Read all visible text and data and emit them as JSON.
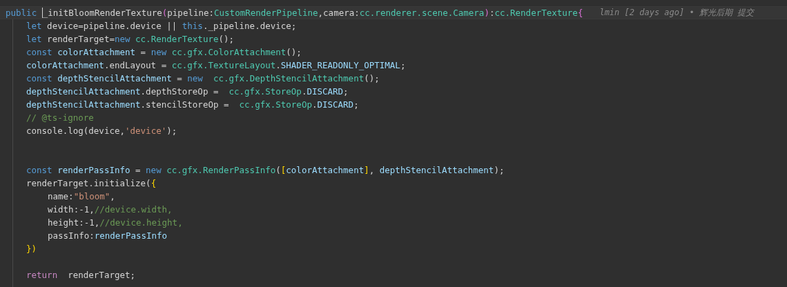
{
  "code": {
    "blame": "lmin [2 days ago] • 辉光后期 提交",
    "lines": [
      {
        "current": true,
        "kind": "top",
        "tokens": [
          {
            "t": "public ",
            "kind": "kw"
          },
          {
            "t": "_initBloomRenderTexture",
            "kind": "plain",
            "cursor": true
          },
          {
            "t": "(",
            "kind": "paren"
          },
          {
            "t": "pipeline:",
            "kind": "plain"
          },
          {
            "t": "CustomRenderPipeline",
            "kind": "type"
          },
          {
            "t": ",camera:",
            "kind": "plain"
          },
          {
            "t": "cc.renderer.scene.Camera",
            "kind": "type"
          },
          {
            "t": ")",
            "kind": "paren"
          },
          {
            "t": ":",
            "kind": "plain"
          },
          {
            "t": "cc.RenderTexture",
            "kind": "type"
          },
          {
            "t": "{",
            "kind": "paren"
          }
        ]
      },
      {
        "current": false,
        "kind": "body",
        "tokens": [
          {
            "t": "let ",
            "kind": "kw"
          },
          {
            "t": "device=pipeline.device || ",
            "kind": "plain"
          },
          {
            "t": "this",
            "kind": "kw"
          },
          {
            "t": "._pipeline.device;",
            "kind": "plain"
          }
        ]
      },
      {
        "current": false,
        "kind": "body",
        "tokens": [
          {
            "t": "let ",
            "kind": "kw"
          },
          {
            "t": "renderTarget=",
            "kind": "plain"
          },
          {
            "t": "new ",
            "kind": "kw"
          },
          {
            "t": "cc.RenderTexture",
            "kind": "type"
          },
          {
            "t": "();",
            "kind": "plain"
          }
        ]
      },
      {
        "current": false,
        "kind": "body",
        "tokens": [
          {
            "t": "const ",
            "kind": "kw"
          },
          {
            "t": "colorAttachment",
            "kind": "var"
          },
          {
            "t": " = ",
            "kind": "plain"
          },
          {
            "t": "new ",
            "kind": "kw"
          },
          {
            "t": "cc.gfx.ColorAttachment",
            "kind": "type"
          },
          {
            "t": "();",
            "kind": "plain"
          }
        ]
      },
      {
        "current": false,
        "kind": "body",
        "tokens": [
          {
            "t": "colorAttachment",
            "kind": "var"
          },
          {
            "t": ".endLayout = ",
            "kind": "plain"
          },
          {
            "t": "cc.gfx.TextureLayout",
            "kind": "type"
          },
          {
            "t": ".",
            "kind": "plain"
          },
          {
            "t": "SHADER_READONLY_OPTIMAL",
            "kind": "var"
          },
          {
            "t": ";",
            "kind": "plain"
          }
        ]
      },
      {
        "current": false,
        "kind": "body",
        "tokens": [
          {
            "t": "const ",
            "kind": "kw"
          },
          {
            "t": "depthStencilAttachment",
            "kind": "var"
          },
          {
            "t": " = ",
            "kind": "plain"
          },
          {
            "t": "new  ",
            "kind": "kw"
          },
          {
            "t": "cc.gfx.DepthStencilAttachment",
            "kind": "type"
          },
          {
            "t": "();",
            "kind": "plain"
          }
        ]
      },
      {
        "current": false,
        "kind": "body",
        "tokens": [
          {
            "t": "depthStencilAttachment",
            "kind": "var"
          },
          {
            "t": ".depthStoreOp =  ",
            "kind": "plain"
          },
          {
            "t": "cc.gfx.StoreOp",
            "kind": "type"
          },
          {
            "t": ".",
            "kind": "plain"
          },
          {
            "t": "DISCARD",
            "kind": "var"
          },
          {
            "t": ";",
            "kind": "plain"
          }
        ]
      },
      {
        "current": false,
        "kind": "body",
        "tokens": [
          {
            "t": "depthStencilAttachment",
            "kind": "var"
          },
          {
            "t": ".stencilStoreOp =  ",
            "kind": "plain"
          },
          {
            "t": "cc.gfx.StoreOp",
            "kind": "type"
          },
          {
            "t": ".",
            "kind": "plain"
          },
          {
            "t": "DISCARD",
            "kind": "var"
          },
          {
            "t": ";",
            "kind": "plain"
          }
        ]
      },
      {
        "current": false,
        "kind": "body",
        "tokens": [
          {
            "t": "// @ts-ignore",
            "kind": "com"
          }
        ]
      },
      {
        "current": false,
        "kind": "body",
        "tokens": [
          {
            "t": "console.log(device,",
            "kind": "plain"
          },
          {
            "t": "'device'",
            "kind": "str"
          },
          {
            "t": ");",
            "kind": "plain"
          }
        ]
      },
      {
        "current": false,
        "kind": "blank"
      },
      {
        "current": false,
        "kind": "blank"
      },
      {
        "current": false,
        "kind": "body",
        "tokens": [
          {
            "t": "const ",
            "kind": "kw"
          },
          {
            "t": "renderPassInfo",
            "kind": "var"
          },
          {
            "t": " = ",
            "kind": "plain"
          },
          {
            "t": "new ",
            "kind": "kw"
          },
          {
            "t": "cc.gfx.RenderPassInfo",
            "kind": "type"
          },
          {
            "t": "(",
            "kind": "plain"
          },
          {
            "t": "[",
            "kind": "brace"
          },
          {
            "t": "colorAttachment",
            "kind": "var"
          },
          {
            "t": "]",
            "kind": "brace"
          },
          {
            "t": ", ",
            "kind": "plain"
          },
          {
            "t": "depthStencilAttachment",
            "kind": "var"
          },
          {
            "t": ");",
            "kind": "plain"
          }
        ]
      },
      {
        "current": false,
        "kind": "body",
        "tokens": [
          {
            "t": "renderTarget.initialize(",
            "kind": "plain"
          },
          {
            "t": "{",
            "kind": "brace"
          }
        ]
      },
      {
        "current": false,
        "kind": "nested",
        "tokens": [
          {
            "t": "name:",
            "kind": "plain"
          },
          {
            "t": "\"bloom\"",
            "kind": "str"
          },
          {
            "t": ",",
            "kind": "plain"
          }
        ]
      },
      {
        "current": false,
        "kind": "nested",
        "tokens": [
          {
            "t": "width:-1,",
            "kind": "plain"
          },
          {
            "t": "//device.width,",
            "kind": "com"
          }
        ]
      },
      {
        "current": false,
        "kind": "nested",
        "tokens": [
          {
            "t": "height:-1,",
            "kind": "plain"
          },
          {
            "t": "//device.height,",
            "kind": "com"
          }
        ]
      },
      {
        "current": false,
        "kind": "nested",
        "tokens": [
          {
            "t": "passInfo:",
            "kind": "plain"
          },
          {
            "t": "renderPassInfo",
            "kind": "var"
          }
        ]
      },
      {
        "current": false,
        "kind": "body",
        "tokens": [
          {
            "t": "})",
            "kind": "brace"
          }
        ]
      },
      {
        "current": false,
        "kind": "blank"
      },
      {
        "current": false,
        "kind": "body",
        "tokens": [
          {
            "t": "return",
            "kind": "ret"
          },
          {
            "t": "  renderTarget;",
            "kind": "plain"
          }
        ]
      }
    ]
  }
}
